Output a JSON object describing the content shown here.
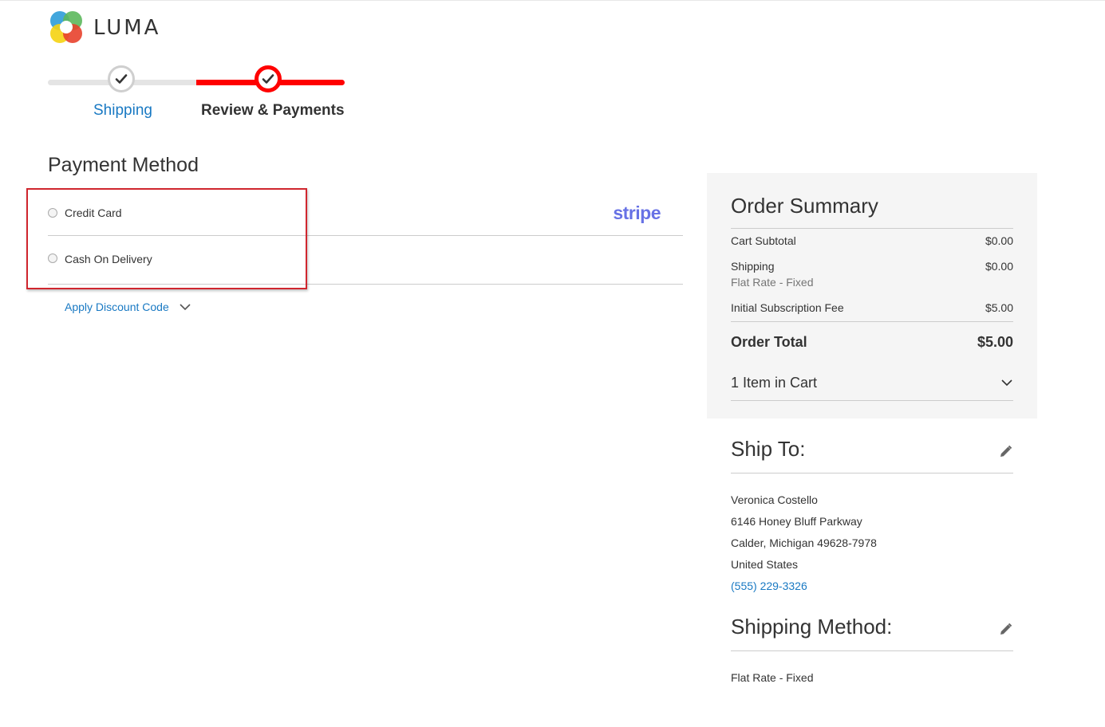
{
  "logo": {
    "text": "LUMA"
  },
  "progress": {
    "steps": [
      {
        "label": "Shipping",
        "state": "complete"
      },
      {
        "label": "Review & Payments",
        "state": "active"
      }
    ],
    "colors": {
      "active": "#ff0000",
      "inactive": "#e4e4e4"
    }
  },
  "payment": {
    "title": "Payment Method",
    "options": [
      {
        "label": "Credit Card",
        "provider_logo": "stripe"
      },
      {
        "label": "Cash On Delivery"
      }
    ],
    "discount_label": "Apply Discount Code"
  },
  "summary": {
    "title": "Order Summary",
    "cart_subtotal_label": "Cart Subtotal",
    "cart_subtotal_value": "$0.00",
    "shipping_label": "Shipping",
    "shipping_method": "Flat Rate - Fixed",
    "shipping_value": "$0.00",
    "fee_label": "Initial Subscription Fee",
    "fee_value": "$5.00",
    "total_label": "Order Total",
    "total_value": "$5.00",
    "items_label": "1 Item in Cart"
  },
  "ship_to": {
    "title": "Ship To:",
    "name": "Veronica Costello",
    "street": "6146 Honey Bluff Parkway",
    "city_line": "Calder, Michigan 49628-7978",
    "country": "United States",
    "phone": "(555) 229-3326"
  },
  "shipping_method": {
    "title": "Shipping Method:",
    "value": "Flat Rate - Fixed"
  }
}
